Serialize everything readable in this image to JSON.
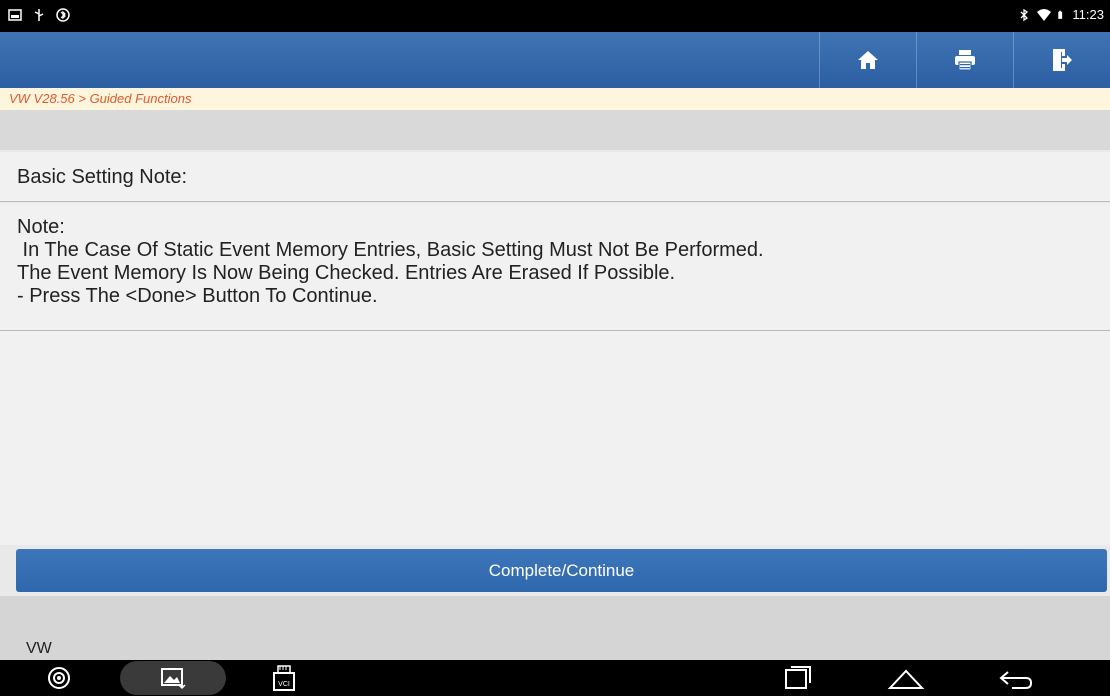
{
  "status_bar": {
    "time": "11:23",
    "left_icons": [
      "image-icon",
      "usb-icon",
      "sync-icon"
    ],
    "right_icons": [
      "bluetooth-icon",
      "wifi-icon",
      "battery-icon"
    ]
  },
  "app_bar": {
    "buttons": [
      "home-icon",
      "print-icon",
      "exit-icon"
    ]
  },
  "breadcrumb": "VW V28.56 > Guided Functions",
  "title_row": "Basic Setting Note:",
  "note_text": "Note:\n In The Case Of Static Event Memory Entries, Basic Setting Must Not Be Performed.\nThe Event Memory Is Now Being Checked. Entries Are Erased If Possible.\n- Press The <Done> Button To Continue.",
  "continue_button": "Complete/Continue",
  "footer_brand": "VW",
  "nav_bar": {
    "vci_label": "VCI",
    "icons": [
      "browser-icon",
      "gallery-icon",
      "vci-icon",
      "recent-apps-icon",
      "home-nav-icon",
      "back-icon"
    ]
  },
  "colors": {
    "app_bar": "#2f64a8",
    "breadcrumb_text": "#e2572d",
    "breadcrumb_bg": "#fdf6dd",
    "continue_button": "#3470b4"
  }
}
